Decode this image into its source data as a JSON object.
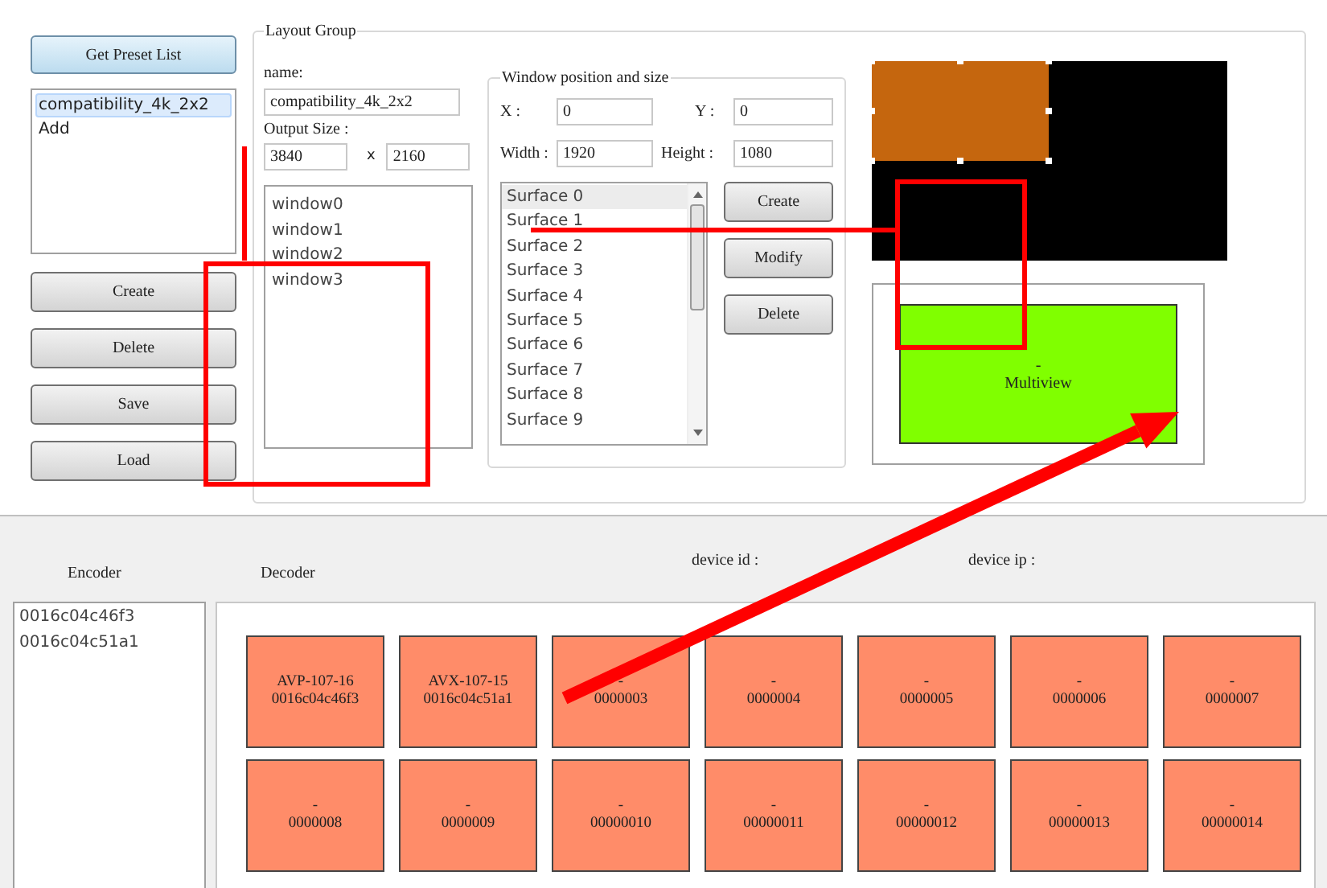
{
  "presets": {
    "get_button": "Get Preset List",
    "items": [
      {
        "label": "compatibility_4k_2x2",
        "selected": true
      },
      {
        "label": "Add",
        "selected": false
      }
    ],
    "buttons": [
      "Create",
      "Delete",
      "Save",
      "Load"
    ]
  },
  "layout_group": {
    "title": "Layout Group",
    "name_label": "name:",
    "name_value": "compatibility_4k_2x2",
    "output_label": "Output Size :",
    "width_value": "3840",
    "times": "x",
    "height_value": "2160",
    "windows": [
      {
        "label": "window0"
      },
      {
        "label": "window1"
      },
      {
        "label": "window2"
      },
      {
        "label": "window3"
      }
    ],
    "position": {
      "title": "Window position and size",
      "x_label": "X :",
      "x_value": "0",
      "y_label": "Y :",
      "y_value": "0",
      "width_label": "Width :",
      "width_value": "1920",
      "height_label": "Height :",
      "height_value": "1080",
      "surfaces": [
        {
          "label": "Surface 0",
          "selected": true
        },
        {
          "label": "Surface 1",
          "selected": false
        },
        {
          "label": "Surface 2",
          "selected": false
        },
        {
          "label": "Surface 3",
          "selected": false
        },
        {
          "label": "Surface 4",
          "selected": false
        },
        {
          "label": "Surface 5",
          "selected": false
        },
        {
          "label": "Surface 6",
          "selected": false
        },
        {
          "label": "Surface 7",
          "selected": false
        },
        {
          "label": "Surface 8",
          "selected": false
        },
        {
          "label": "Surface 9",
          "selected": false
        }
      ],
      "buttons": [
        "Create",
        "Modify",
        "Delete"
      ]
    },
    "multiview": {
      "line_1": "-",
      "line_2": "Multiview"
    }
  },
  "bottom": {
    "encoder_label": "Encoder",
    "decoder_label": "Decoder",
    "device_id_label": "device id :",
    "device_ip_label": "device ip :",
    "encoders": [
      "0016c04c46f3",
      "0016c04c51a1"
    ],
    "decoders": [
      {
        "line_1": "AVP-107-16",
        "line_2": "0016c04c46f3"
      },
      {
        "line_1": "AVX-107-15",
        "line_2": "0016c04c51a1"
      },
      {
        "line_1": "-",
        "line_2": "0000003"
      },
      {
        "line_1": "-",
        "line_2": "0000004"
      },
      {
        "line_1": "-",
        "line_2": "0000005"
      },
      {
        "line_1": "-",
        "line_2": "0000006"
      },
      {
        "line_1": "-",
        "line_2": "0000007"
      },
      {
        "line_1": "-",
        "line_2": "0000008"
      },
      {
        "line_1": "-",
        "line_2": "0000009"
      },
      {
        "line_1": "-",
        "line_2": "00000010"
      },
      {
        "line_1": "-",
        "line_2": "00000011"
      },
      {
        "line_1": "-",
        "line_2": "00000012"
      },
      {
        "line_1": "-",
        "line_2": "00000013"
      },
      {
        "line_1": "-",
        "line_2": "00000014"
      }
    ]
  },
  "annotations": [
    {
      "kind": "box"
    },
    {
      "kind": "box"
    },
    {
      "kind": "line"
    },
    {
      "kind": "line"
    },
    {
      "kind": "arrow"
    }
  ]
}
